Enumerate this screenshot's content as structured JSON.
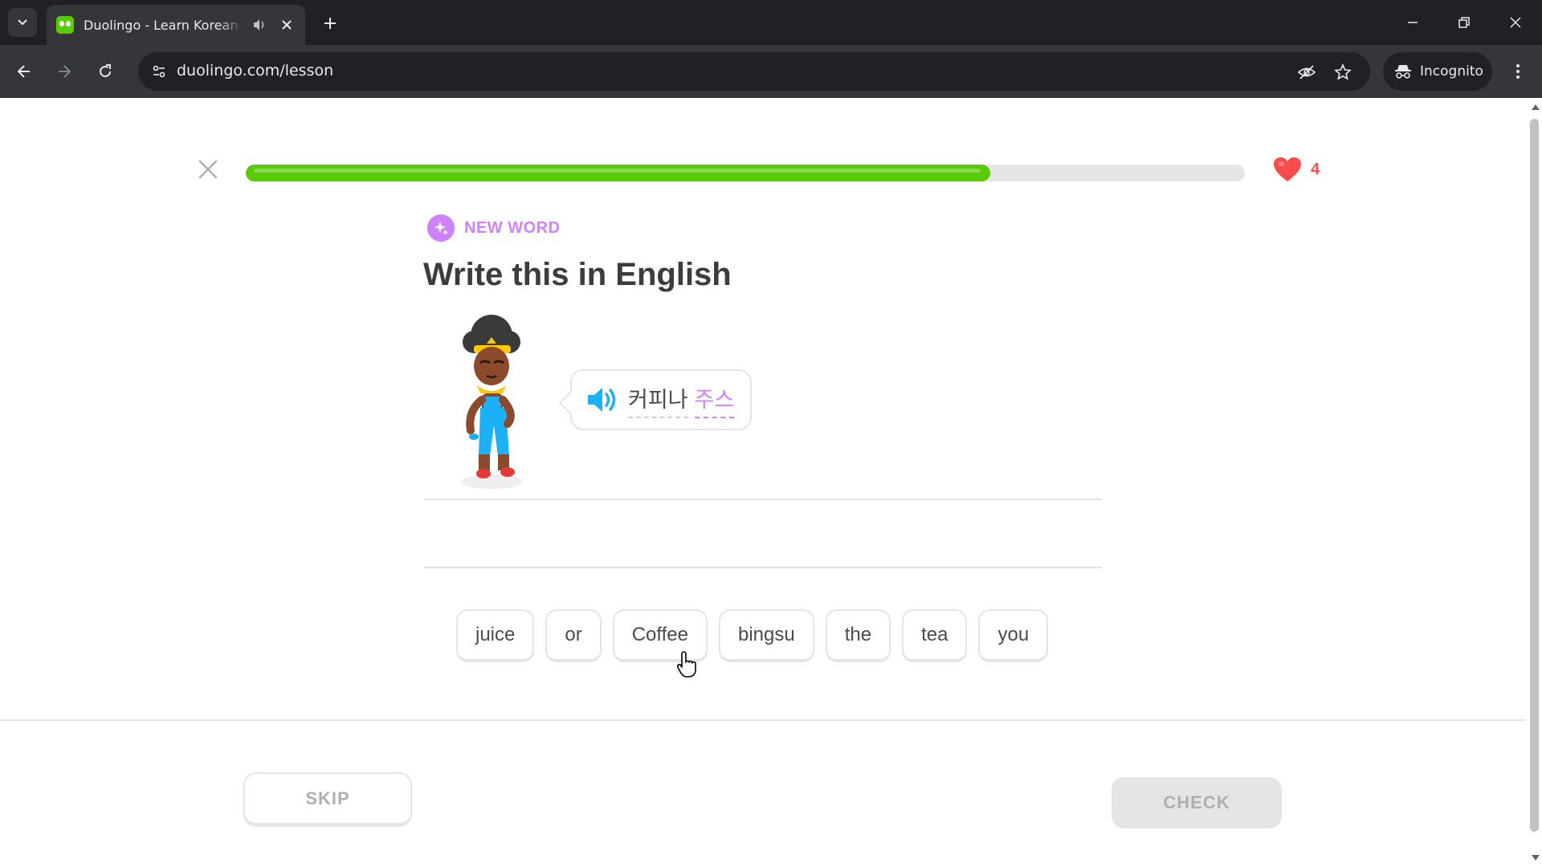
{
  "browser": {
    "tab_title": "Duolingo - Learn Korean with",
    "url": "duolingo.com/lesson",
    "incognito_label": "Incognito"
  },
  "lesson": {
    "progress_fraction": 0.745,
    "hearts": "4",
    "badge_label": "NEW WORD",
    "instruction": "Write this in English",
    "prompt_words": [
      "커피나",
      "주스"
    ],
    "word_bank": [
      "juice",
      "or",
      "Coffee",
      "bingsu",
      "the",
      "tea",
      "you"
    ],
    "skip_label": "SKIP",
    "check_label": "CHECK"
  },
  "colors": {
    "progress_green": "#58cc02",
    "heart_red": "#ff4b4b",
    "new_word_purple": "#ce82ff",
    "speaker_blue": "#1cb0f6"
  }
}
